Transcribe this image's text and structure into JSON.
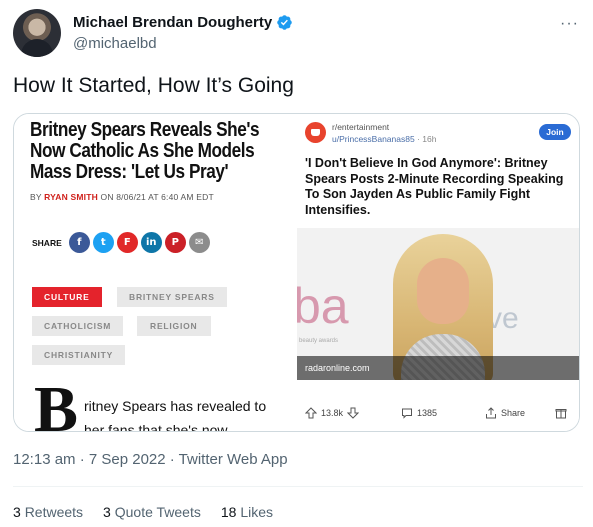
{
  "author": {
    "name": "Michael Brendan Dougherty",
    "handle": "@michaelbd",
    "verified": true,
    "more_label": "···"
  },
  "tweet": {
    "text": "How It Started, How It’s Going",
    "timestamp": "12:13 am · 7 Sep 2022 · Twitter Web App"
  },
  "stats": {
    "retweets_count": "3",
    "retweets_label": "Retweets",
    "quotes_count": "3",
    "quotes_label": "Quote Tweets",
    "likes_count": "18",
    "likes_label": "Likes"
  },
  "article": {
    "title": "Britney Spears Reveals She's Now Catholic As She Models Mass Dress: 'Let Us Pray'",
    "by": "BY",
    "author": "RYAN SMITH",
    "date": "ON 8/06/21 AT 6:40 AM EDT",
    "share_label": "SHARE",
    "share_icons": [
      {
        "name": "facebook-icon",
        "glyph": "f",
        "color": "#3b5998"
      },
      {
        "name": "twitter-icon",
        "glyph": "t",
        "color": "#1da1f2"
      },
      {
        "name": "flipboard-icon",
        "glyph": "F",
        "color": "#e12828"
      },
      {
        "name": "linkedin-icon",
        "glyph": "in",
        "color": "#0e76a8"
      },
      {
        "name": "pinterest-icon",
        "glyph": "P",
        "color": "#cb2027"
      },
      {
        "name": "email-icon",
        "glyph": "✉",
        "color": "#8c8c8c"
      }
    ],
    "tags": [
      "CULTURE",
      "BRITNEY SPEARS",
      "CATHOLICISM",
      "RELIGION",
      "CHRISTIANITY"
    ],
    "dropcap": "B",
    "body": "ritney Spears has revealed to her fans that she's now"
  },
  "reddit": {
    "subreddit": "r/entertainment",
    "user": "u/PrincessBananas85",
    "time": "· 16h",
    "join_label": "Join",
    "title": "'I Don't Believe In God Anymore': Britney Spears Posts 2-Minute Recording Speaking To Son Jayden As Public Family Fight Intensifies.",
    "photo_caption": "radaronline.com",
    "photo_logo_sub": "beauty awards",
    "votes": "13.8k",
    "comments": "1385",
    "share_label": "Share"
  },
  "colors": {
    "accent": "#1d9bf0",
    "tag_red": "#e4232c",
    "reddit_blue": "#2a6bd4"
  }
}
